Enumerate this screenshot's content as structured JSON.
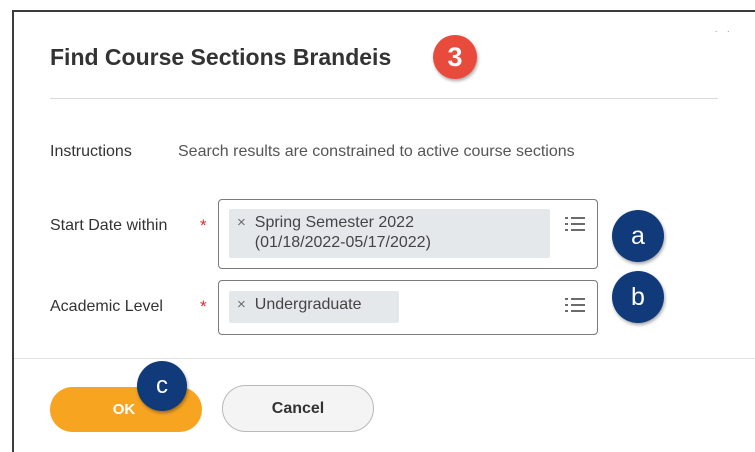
{
  "dialog": {
    "title": "Find Course Sections Brandeis",
    "step_badge": "3",
    "corner_dots": "· ·"
  },
  "instructions": {
    "label": "Instructions",
    "text": "Search results are constrained to active course sections"
  },
  "fields": [
    {
      "label": "Start Date within",
      "required_mark": "*",
      "selected_line1": "Spring Semester 2022",
      "selected_line2": "(01/18/2022-05/17/2022)",
      "remove_glyph": "×",
      "callout": "a"
    },
    {
      "label": "Academic Level",
      "required_mark": "*",
      "selected_line1": "Undergraduate",
      "remove_glyph": "×",
      "callout": "b"
    }
  ],
  "buttons": {
    "ok_label": "OK",
    "cancel_label": "Cancel",
    "ok_callout": "c"
  },
  "colors": {
    "ok_button": "#f7a521",
    "badge_red": "#e84a3b",
    "badge_navy": "#113a7a",
    "required": "#de2c2c"
  },
  "icons": {
    "remove": "close-icon",
    "prompt": "list-menu-icon"
  }
}
